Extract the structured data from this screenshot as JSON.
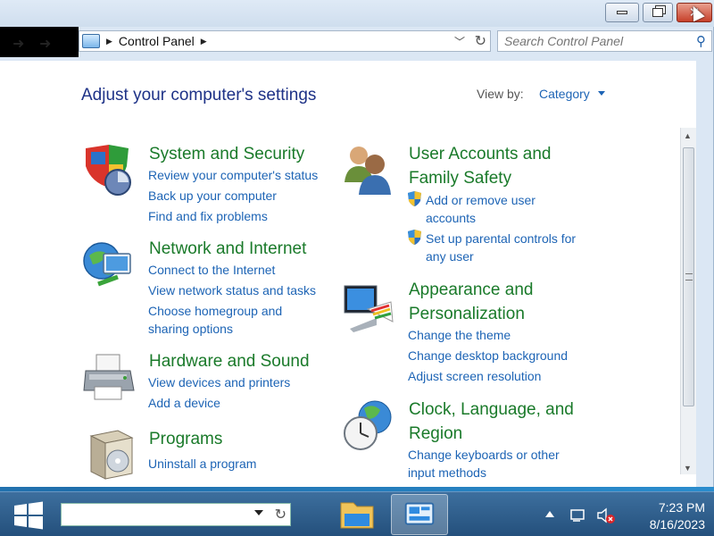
{
  "window": {
    "buttons": {
      "minimize": "minimize",
      "maximize": "restore",
      "close": "close"
    }
  },
  "address_bar": {
    "breadcrumb": "Control Panel"
  },
  "search": {
    "placeholder": "Search Control Panel"
  },
  "header": {
    "title": "Adjust your computer's settings",
    "view_by_label": "View by:",
    "view_by_value": "Category"
  },
  "categories": [
    {
      "title": "System and Security",
      "icon": "system-security-icon",
      "links": [
        "Review your computer's status",
        "Back up your computer",
        "Find and fix problems"
      ]
    },
    {
      "title": "Network and Internet",
      "icon": "network-globe-icon",
      "links": [
        "Connect to the Internet",
        "View network status and tasks",
        "Choose homegroup and",
        "sharing options"
      ]
    },
    {
      "title": "Hardware and Sound",
      "icon": "printer-icon",
      "links": [
        "View devices and printers",
        "Add a device"
      ]
    },
    {
      "title": "Programs",
      "icon": "programs-box-icon",
      "links": [
        "Uninstall a program"
      ]
    },
    {
      "title_line1": "User Accounts and",
      "title_line2": "Family Safety",
      "icon": "users-icon",
      "links": [
        "Add or remove user",
        "accounts",
        "Set up parental controls for",
        "any user"
      ]
    },
    {
      "title_line1": "Appearance and",
      "title_line2": "Personalization",
      "icon": "monitor-palette-icon",
      "links": [
        "Change the theme",
        "Change desktop background",
        "Adjust screen resolution"
      ]
    },
    {
      "title_line1": "Clock, Language, and",
      "title_line2": "Region",
      "icon": "clock-globe-icon",
      "links": [
        "Change keyboards or other",
        "input methods"
      ]
    }
  ],
  "taskbar": {
    "apps": [
      "file-explorer-icon",
      "control-panel-icon"
    ],
    "time": "7:23 PM",
    "date": "8/16/2023"
  },
  "colors": {
    "title_green": "#1a7a2a",
    "link_blue": "#1d64b5",
    "header_blue": "#1e3287",
    "taskbar": "#2f5f8e"
  }
}
